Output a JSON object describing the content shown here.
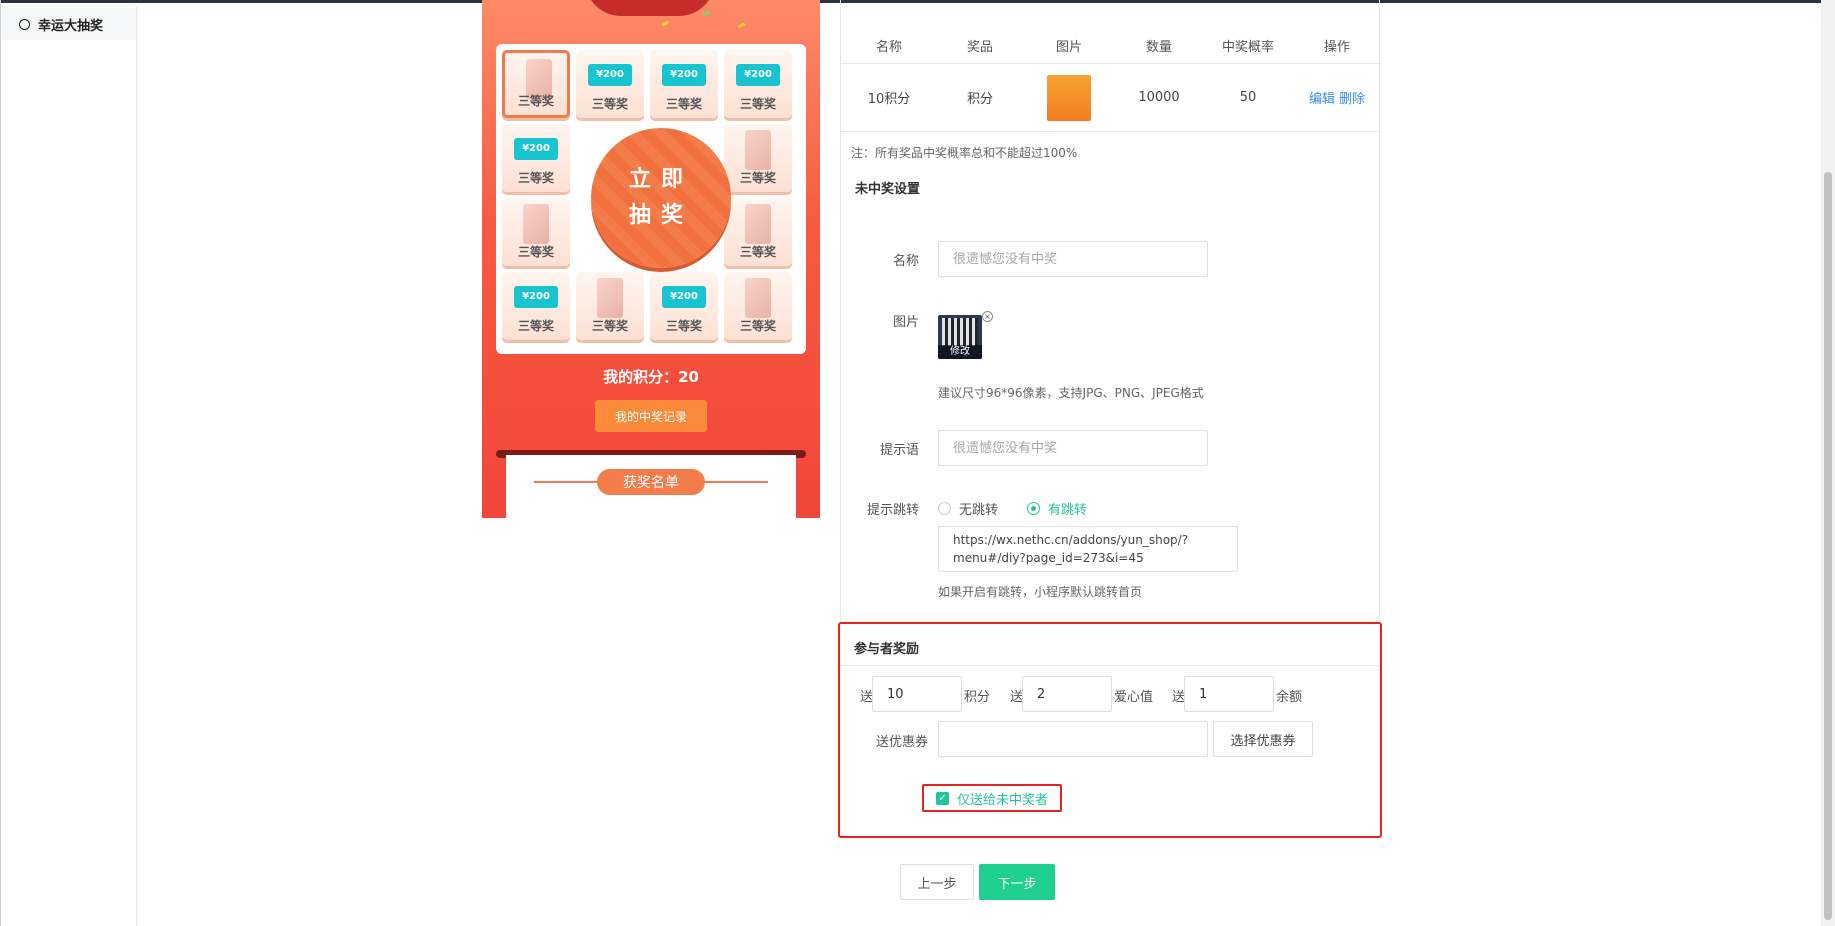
{
  "sidebar": {
    "items": [
      {
        "label": "幸运大抽奖"
      }
    ]
  },
  "preview": {
    "cells": [
      {
        "label": "三等奖",
        "kind": "phone"
      },
      {
        "label": "三等奖",
        "kind": "ticket"
      },
      {
        "label": "三等奖",
        "kind": "ticket"
      },
      {
        "label": "三等奖",
        "kind": "ticket"
      },
      {
        "label": "三等奖",
        "kind": "ticket"
      },
      {
        "label": "三等奖",
        "kind": "phone"
      },
      {
        "label": "三等奖",
        "kind": "phone"
      },
      {
        "label": "三等奖",
        "kind": "phone"
      },
      {
        "label": "三等奖",
        "kind": "ticket"
      },
      {
        "label": "三等奖",
        "kind": "phone"
      },
      {
        "label": "三等奖",
        "kind": "ticket"
      },
      {
        "label": "三等奖",
        "kind": "phone"
      }
    ],
    "ticket_text": "¥200",
    "draw_line1": "立即",
    "draw_line2": "抽奖",
    "points_label": "我的积分：20",
    "record_button": "我的中奖记录",
    "winners_title": "获奖名单"
  },
  "prize_table": {
    "headers": [
      "名称",
      "奖品",
      "图片",
      "数量",
      "中奖概率",
      "操作"
    ],
    "rows": [
      {
        "name": "10积分",
        "prize": "积分",
        "quantity": "10000",
        "probability": "50",
        "edit": "编辑",
        "delete": "删除"
      }
    ]
  },
  "note": "注：所有奖品中奖概率总和不能超过100%",
  "no_prize": {
    "section_title": "未中奖设置",
    "name_label": "名称",
    "name_placeholder": "很遗憾您没有中奖",
    "image_label": "图片",
    "image_edit": "修改",
    "image_hint": "建议尺寸96*96像素，支持JPG、PNG、JPEG格式",
    "tip_label": "提示语",
    "tip_placeholder": "很遗憾您没有中奖",
    "jump_label": "提示跳转",
    "jump_options": [
      "无跳转",
      "有跳转"
    ],
    "jump_selected": "有跳转",
    "jump_url": "https://wx.nethc.cn/addons/yun_shop/?menu#/diy?page_id=273&i=45",
    "jump_hint": "如果开启有跳转，小程序默认跳转首页"
  },
  "participant": {
    "section_title": "参与者奖励",
    "send": "送",
    "points_value": "10",
    "points_unit": "积分",
    "love_value": "2",
    "love_unit": "爱心值",
    "balance_value": "1",
    "balance_unit": "余额",
    "coupon_label": "送优惠券",
    "coupon_button": "选择优惠券",
    "only_losers": "仅送给未中奖者"
  },
  "footer": {
    "prev": "上一步",
    "next": "下一步"
  },
  "colors": {
    "accent": "#23c39b",
    "primary_button": "#1ecf8d",
    "highlight": "#e8231f",
    "link": "#3a8ee6"
  }
}
